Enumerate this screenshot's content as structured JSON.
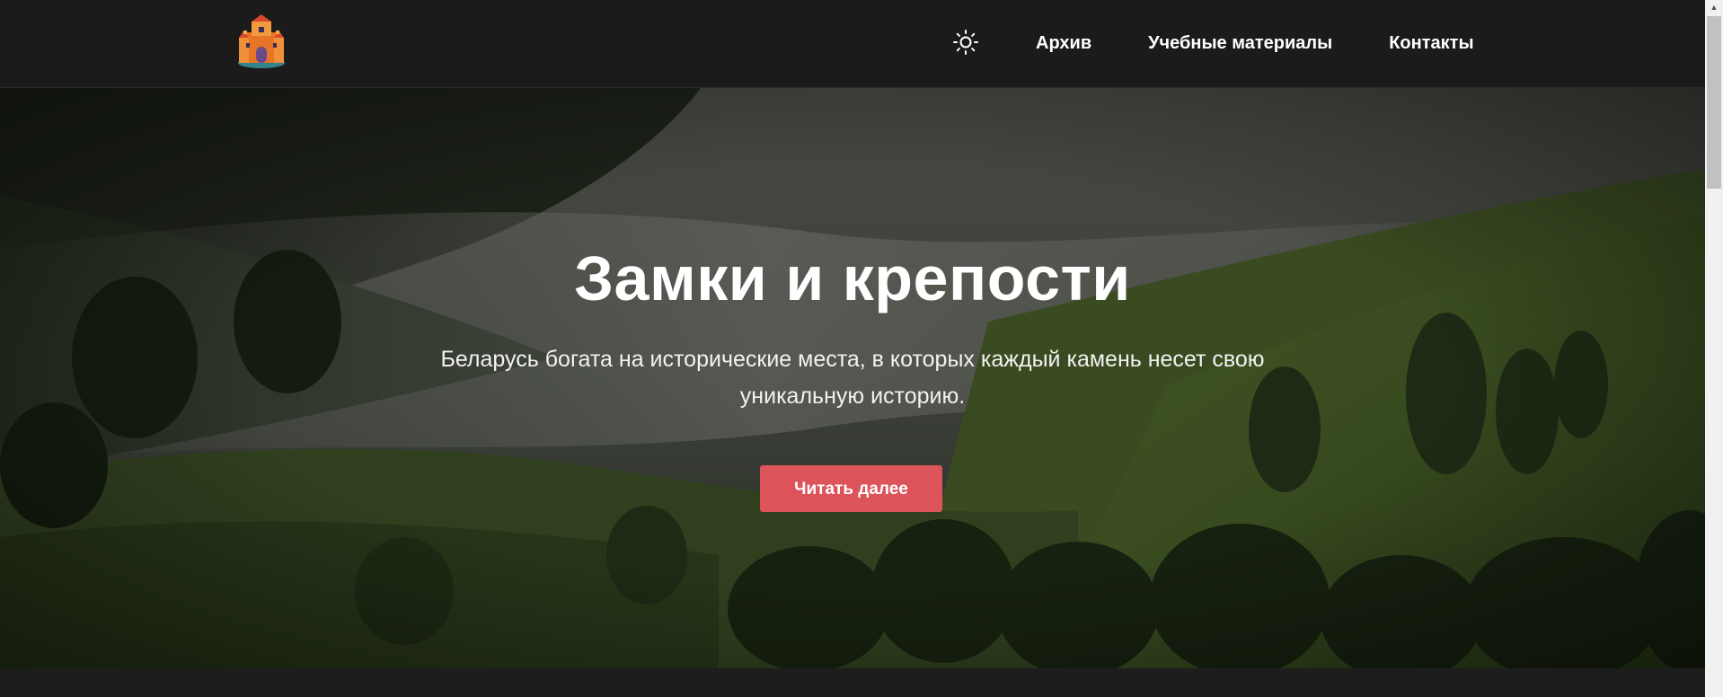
{
  "header": {
    "logo_icon": "castle-logo-icon",
    "theme_toggle_icon": "sun-icon",
    "nav": [
      {
        "label": "Архив"
      },
      {
        "label": "Учебные материалы"
      },
      {
        "label": "Контакты"
      }
    ]
  },
  "hero": {
    "title": "Замки и крепости",
    "subtitle": "Беларусь богата на исторические места, в которых каждый камень несет свою уникальную историю.",
    "cta_label": "Читать далее",
    "background": "misty-green-hills-photo",
    "accent_color": "#dc535a"
  },
  "scrollbar": {
    "up_icon": "scroll-up-arrow-icon"
  }
}
